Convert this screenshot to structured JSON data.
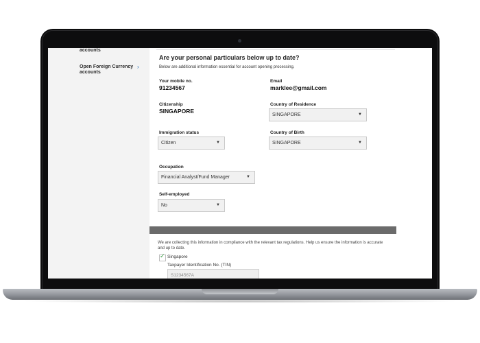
{
  "sidebar": {
    "items": [
      {
        "label": "accounts"
      },
      {
        "label": "Open Foreign Currency accounts"
      }
    ],
    "chevron": "›"
  },
  "main": {
    "heading": "Are your personal particulars below up to date?",
    "subtext": "Below are additional information essential for account opening processing.",
    "mobile": {
      "label": "Your mobile no.",
      "value": "91234567"
    },
    "email": {
      "label": "Email",
      "value": "marklee@gmail.com"
    },
    "citizenship": {
      "label": "Citizenship",
      "value": "SINGAPORE"
    },
    "country_residence": {
      "label": "Country of Residence",
      "value": "SINGAPORE"
    },
    "immigration_status": {
      "label": "Immigration status",
      "value": "Citizen"
    },
    "country_birth": {
      "label": "Country of Birth",
      "value": "SINGAPORE"
    },
    "occupation": {
      "label": "Occupation",
      "value": "Financial Analyst/Fund Manager"
    },
    "self_employed": {
      "label": "Self-employed",
      "value": "No"
    }
  },
  "tax": {
    "compliance_text": "We are collecting this information in compliance with the relevant tax regulations. Help us ensure the information is accurate and up to date.",
    "country_label": "Singapore",
    "tin_label": "Taxpayer Identification No. (TIN)",
    "tin_value": "S1234567A"
  },
  "icons": {
    "dropdown_arrow": "▼",
    "checkmark": "✓"
  },
  "colors": {
    "accent_blue": "#1f6fb5",
    "check_green": "#2e9b3b",
    "band_grey": "#6b6b6b"
  }
}
